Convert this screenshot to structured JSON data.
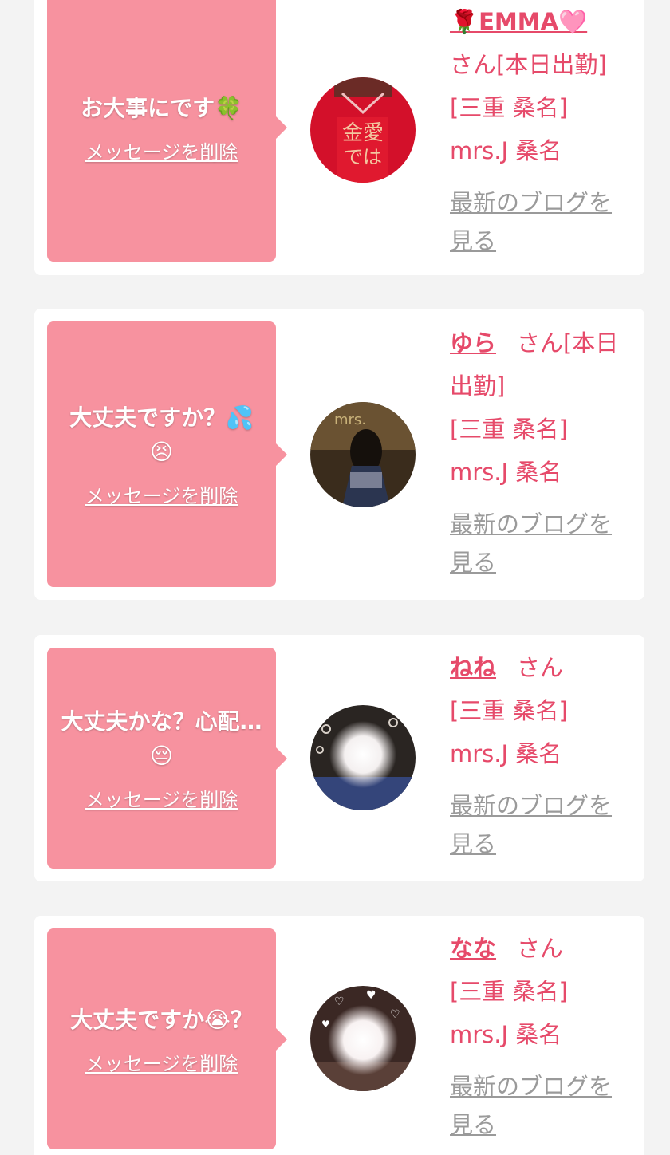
{
  "messages": [
    {
      "text": "お大事にです🍀",
      "delete_label": "メッセージを削除",
      "name": "🌹EMMA🩷",
      "status": "さん[本日出勤]",
      "shop": "[三重 桑名] mrs.J 桑名",
      "blog_label": "最新のブログを見る"
    },
    {
      "text": "大丈夫ですか？💦😣",
      "delete_label": "メッセージを削除",
      "name": "ゆら",
      "status": "さん[本日出勤]",
      "shop": "[三重 桑名] mrs.J 桑名",
      "blog_label": "最新のブログを見る"
    },
    {
      "text": "大丈夫かな？心配…😔",
      "delete_label": "メッセージを削除",
      "name": "ねね",
      "status": "さん",
      "shop": "[三重 桑名] mrs.J 桑名",
      "blog_label": "最新のブログを見る"
    },
    {
      "text": "大丈夫ですか😭？",
      "delete_label": "メッセージを削除",
      "name": "なな",
      "status": "さん",
      "shop": "[三重 桑名] mrs.J 桑名",
      "blog_label": "最新のブログを見る"
    }
  ],
  "colors": {
    "bubble": "#f7929f",
    "accent": "#e64a6a",
    "link_gray": "#9a9a9a",
    "background": "#f3f3f3"
  }
}
